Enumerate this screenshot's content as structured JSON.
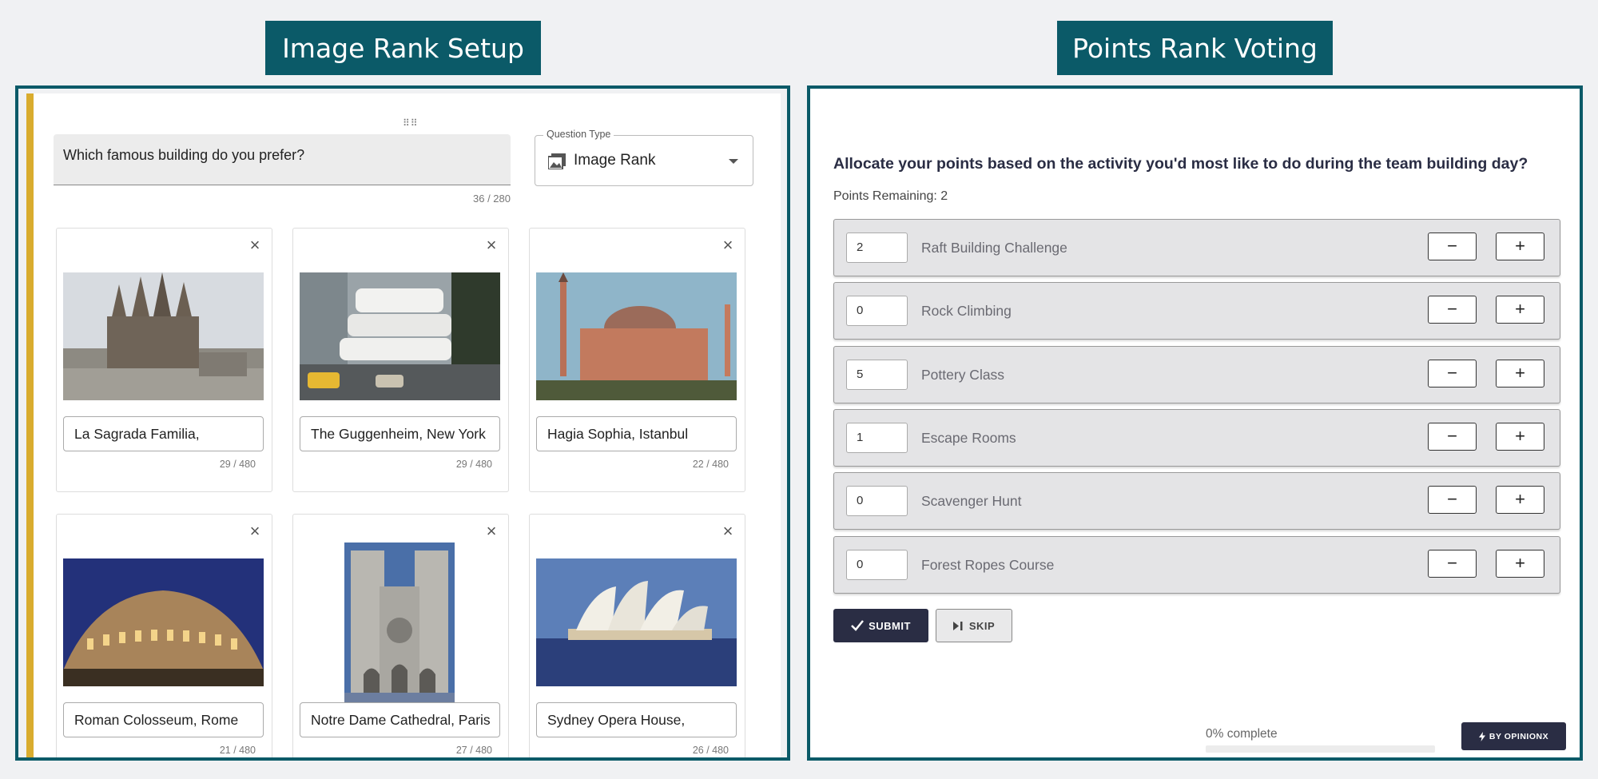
{
  "left_panel": {
    "banner": "Image Rank Setup",
    "question_text": "Which famous building do you prefer?",
    "question_counter": "36 / 280",
    "question_type": {
      "label": "Question Type",
      "value": "Image Rank",
      "icon": "image-icon"
    },
    "tiles": [
      {
        "caption": "La Sagrada Familia,",
        "counter": "29 / 480",
        "image": "sagrada-familia"
      },
      {
        "caption": "The Guggenheim, New York",
        "counter": "29 / 480",
        "image": "guggenheim"
      },
      {
        "caption": "Hagia Sophia, Istanbul",
        "counter": "22 / 480",
        "image": "hagia-sophia"
      },
      {
        "caption": "Roman Colosseum, Rome",
        "counter": "21 / 480",
        "image": "colosseum"
      },
      {
        "caption": "Notre Dame Cathedral, Paris",
        "counter": "27 / 480",
        "image": "notre-dame"
      },
      {
        "caption": "Sydney Opera House,",
        "counter": "26 / 480",
        "image": "sydney-opera-house"
      }
    ]
  },
  "right_panel": {
    "banner": "Points Rank Voting",
    "question": "Allocate your points based on the activity you'd most like to do during the team building day?",
    "points_remaining": "Points Remaining: 2",
    "options": [
      {
        "value": "2",
        "label": "Raft Building Challenge"
      },
      {
        "value": "0",
        "label": "Rock Climbing"
      },
      {
        "value": "5",
        "label": "Pottery Class"
      },
      {
        "value": "1",
        "label": "Escape Rooms"
      },
      {
        "value": "0",
        "label": "Scavenger Hunt"
      },
      {
        "value": "0",
        "label": "Forest Ropes Course"
      }
    ],
    "minus_symbol": "−",
    "plus_symbol": "+",
    "submit_label": "SUBMIT",
    "skip_label": "SKIP",
    "progress_text": "0% complete",
    "progress_fraction": 0,
    "badge_label": "BY OPINIONX"
  },
  "colors": {
    "teal": "#0b5a68",
    "navy": "#2a2d44",
    "gold": "#d9ac2e"
  }
}
